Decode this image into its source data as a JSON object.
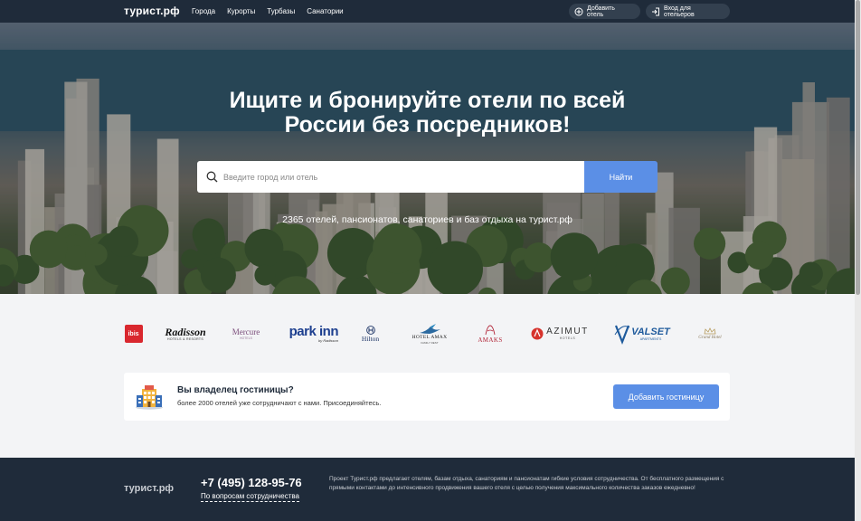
{
  "header": {
    "logo": "турист.рф",
    "nav": [
      "Города",
      "Курорты",
      "Турбазы",
      "Санатории"
    ],
    "add_hotel": "Добавить отель",
    "login": "Вход для отельеров"
  },
  "hero": {
    "title_line1": "Ищите и бронируйте отели по всей",
    "title_line2": "России без посредников!",
    "search_placeholder": "Введите город или отель",
    "search_button": "Найти",
    "subtitle": "2365 отелей, пансионатов, санаториев и баз отдыха на турист.рф"
  },
  "brands": {
    "ibis": "ibis",
    "radisson": "Radisson",
    "radisson_sub": "HOTELS & RESORTS",
    "mercure": "Mercure",
    "mercure_sub": "HOTELS",
    "parkinn": "park inn",
    "parkinn_sub": "by Radisson",
    "hilton": "Hilton",
    "amax": "HOTEL AMAX",
    "amax_sub": "FAMILY REST",
    "amaks": "AMAKS",
    "azimut": "AZIMUT",
    "azimut_sub": "HOTELS",
    "valset": "VALSET",
    "valset_sub": "APARTMENTS",
    "grand": "Grand Hotel"
  },
  "owner": {
    "title": "Вы владелец гостиницы?",
    "subtitle": "более 2000 отелей уже сотрудничают с нами. Присоединяйтесь.",
    "button": "Добавить гостиницу"
  },
  "footer": {
    "logo": "турист.рф",
    "phone": "+7 (495) 128-95-76",
    "cooperation": "По вопросам сотрудничества",
    "text": "Проект Турист.рф предлагает отелям, базам отдыха, санаториям и пансионатам гибкие условия сотрудничества. От бесплатного размещения с прямыми контактами до интенсивного продвижения вашего отеля с целью получения максимального количества заказов ежедневно!"
  },
  "colors": {
    "header_bg": "#1f2b3a",
    "accent": "#5b8fe6",
    "ibis": "#d9272e",
    "azimut": "#d6322c",
    "parkinn": "#1d3f8f",
    "valset": "#1e5a9c"
  },
  "icons": {
    "add_hotel": "plus-circle-icon",
    "login": "login-icon",
    "search": "search-icon",
    "owner": "hotel-building-icon"
  }
}
